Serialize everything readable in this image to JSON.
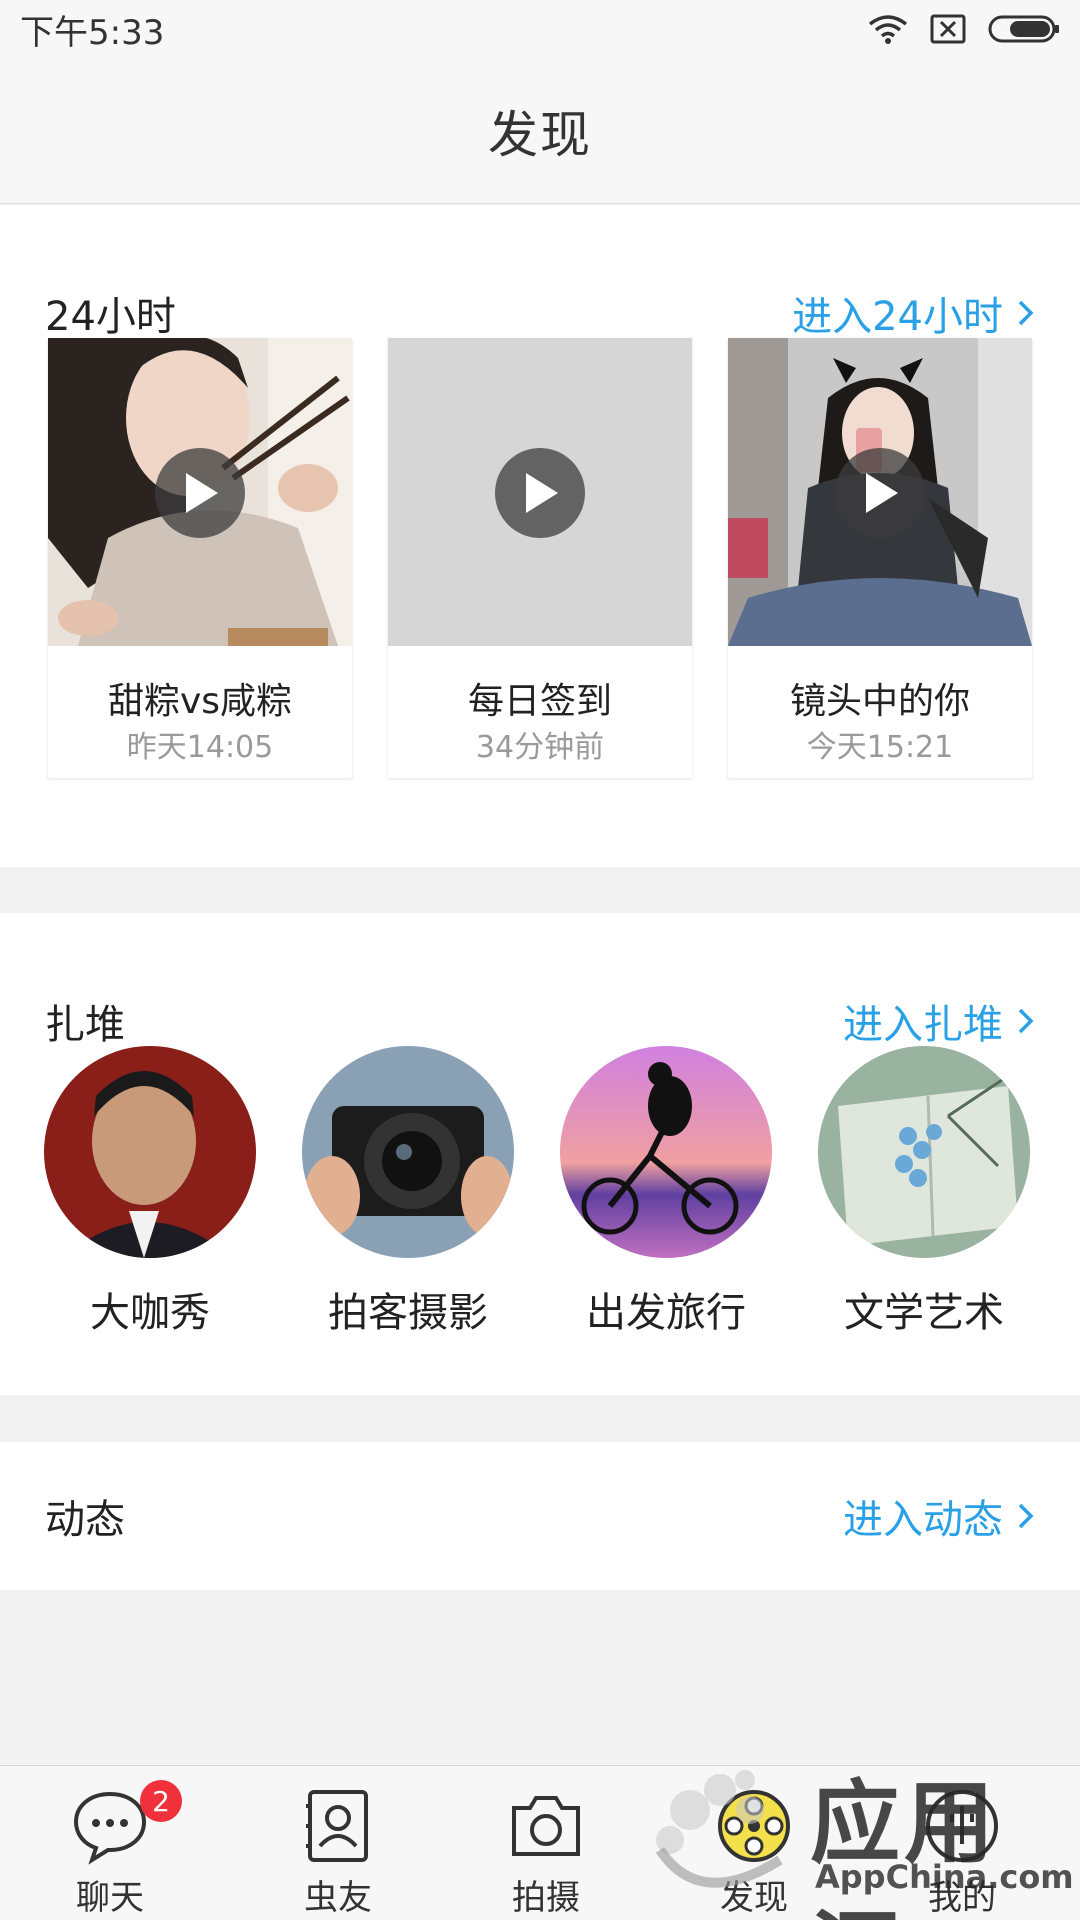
{
  "status_bar": {
    "time": "下午5:33",
    "icons": [
      "wifi-icon",
      "sim-x-icon",
      "battery-icon"
    ]
  },
  "header": {
    "title": "发现"
  },
  "section_24h": {
    "title": "24小时",
    "link_label": "进入24小时",
    "cards": [
      {
        "title": "甜粽vs咸粽",
        "time": "昨天14:05"
      },
      {
        "title": "每日签到",
        "time": "34分钟前"
      },
      {
        "title": "镜头中的你",
        "time": "今天15:21"
      }
    ]
  },
  "section_groups": {
    "title": "扎堆",
    "link_label": "进入扎堆",
    "groups": [
      {
        "label": "大咖秀"
      },
      {
        "label": "拍客摄影"
      },
      {
        "label": "出发旅行"
      },
      {
        "label": "文学艺术"
      }
    ]
  },
  "section_feed": {
    "title": "动态",
    "link_label": "进入动态"
  },
  "tab_bar": {
    "tabs": [
      {
        "label": "聊天",
        "icon": "chat-bubble-icon",
        "badge": "2"
      },
      {
        "label": "虫友",
        "icon": "contacts-icon"
      },
      {
        "label": "拍摄",
        "icon": "camera-icon"
      },
      {
        "label": "发现",
        "icon": "film-reel-icon",
        "active": true
      },
      {
        "label": "我的",
        "icon": "profile-icon"
      }
    ]
  },
  "watermark": {
    "main": "应用汇",
    "sub": "AppChina.com"
  },
  "colors": {
    "accent": "#2aa0e6",
    "badge": "#f0303a",
    "background": "#f2f2f2"
  }
}
